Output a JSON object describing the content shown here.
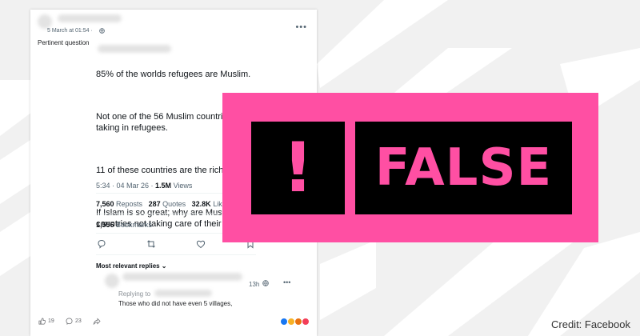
{
  "colors": {
    "accent_pink": "#ff4fa3",
    "box_black": "#000000",
    "background": "#f1f1f1"
  },
  "post": {
    "timestamp": "5 March at 01:54 · ",
    "globe_icon": "globe-icon",
    "more_icon": "more-horizontal-icon",
    "more_text": "•••",
    "caption": "Pertinent question"
  },
  "tweet": {
    "lines": [
      "85% of the worlds refugees are Muslim.",
      "Not one of the 56 Muslim countries are taking in refugees.",
      "11 of these countries are the riches world.",
      "If Islam is so great; why are Muslim countries not taking care of their o"
    ],
    "time_date": "5:34 · 04 Mar 26 · ",
    "views_count": "1.5M",
    "views_label": " Views",
    "reposts_count": "7,560",
    "reposts_label": " Reposts",
    "quotes_count": "287",
    "quotes_label": " Quotes",
    "likes_count": "32.8K",
    "likes_label": " Likes",
    "bookmarks_count": "1,556",
    "bookmarks_label": " Bookmarks",
    "action_icons": [
      "reply-icon",
      "repost-icon",
      "like-icon",
      "bookmark-icon"
    ],
    "most_relevant": "Most relevant replies ⌄"
  },
  "reply": {
    "time": "13h",
    "more_text": "•••",
    "replying_to": "Replying to",
    "text": "Those who did not have even 5 villages,"
  },
  "fb_bar": {
    "likes": "19",
    "comments": "23",
    "icons": [
      "like-icon",
      "comment-icon",
      "share-icon"
    ]
  },
  "stamp": {
    "bang": "!",
    "label": "FALSE"
  },
  "credit": "Credit: Facebook"
}
